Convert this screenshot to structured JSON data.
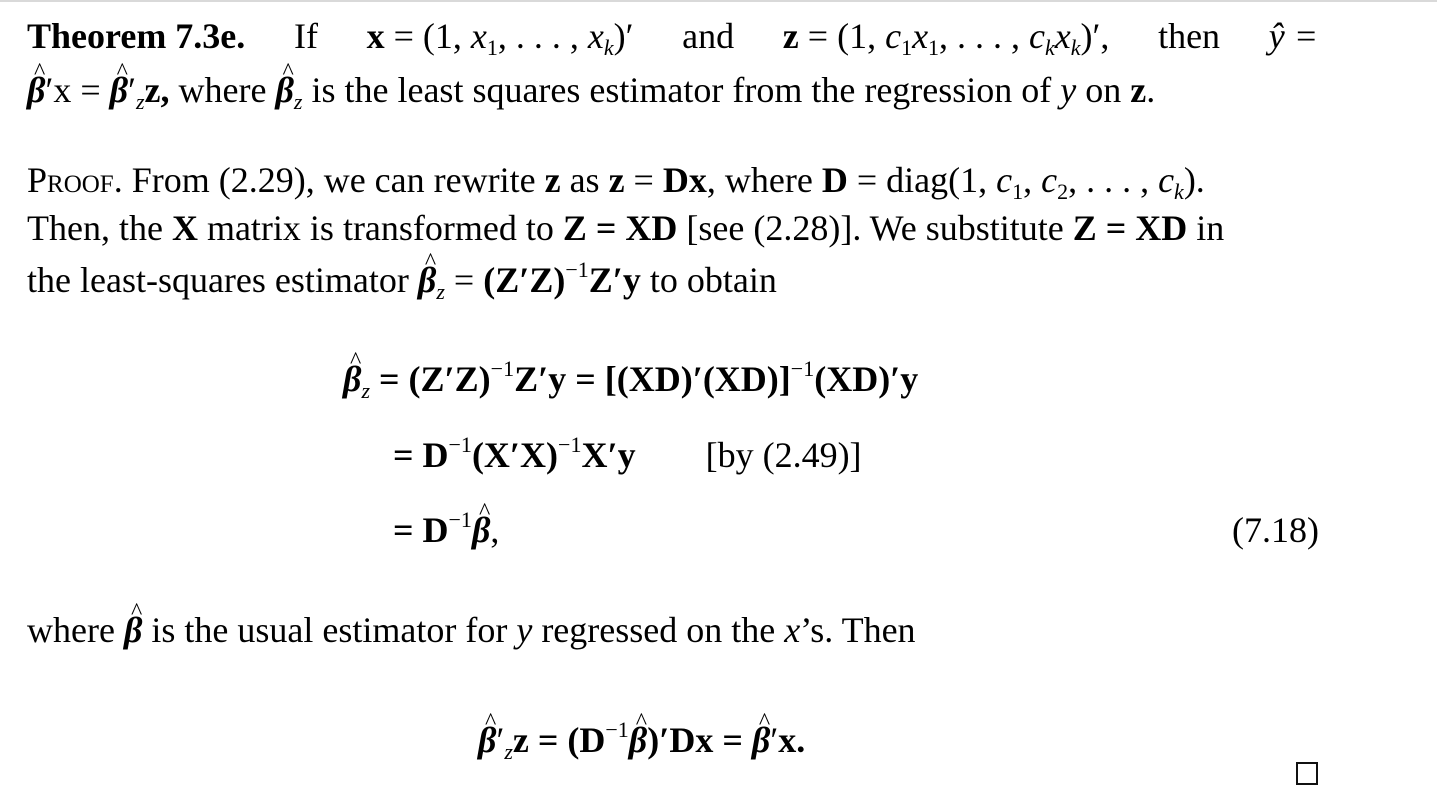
{
  "theorem": {
    "label": "Theorem 7.3e.",
    "line1": {
      "lead": "If",
      "x_def": "x = (1, x",
      "x_sub1": "1",
      "x_mid": ", . . . , x",
      "x_subk": "k",
      "x_end": ")′",
      "and": "and",
      "z_def": "z = (1, c",
      "z_sub1": "1",
      "z_x": "x",
      "z_sub1b": "1",
      "z_mid": ", . . . , c",
      "z_subk": "k",
      "z_x2": "x",
      "z_subk2": "k",
      "z_end": ")′,",
      "then": "then",
      "yhat": "ŷ =",
      "eq_tail": ""
    },
    "line2": {
      "beta1": "β",
      "p1": "′x = ",
      "beta2": "β",
      "p2": "′",
      "sub_z": "z",
      "p3": "z,",
      "where": " where ",
      "beta3": "β",
      "sub_z2": "z",
      "rest": " is the least squares estimator from the regression of ",
      "y": "y",
      "on": " on ",
      "z": "z",
      "dot": "."
    }
  },
  "proof": {
    "label": "Proof.",
    "line1": {
      "a": " From (2.29), we can rewrite ",
      "z1": "z",
      "b": " as ",
      "z2": "z",
      "c": " = ",
      "dx": "Dx",
      "d": ", where ",
      "D": "D",
      "e": " = diag(1, ",
      "c1": "c",
      "c1s": "1",
      "f": ", ",
      "c2": "c",
      "c2s": "2",
      "g": ", . . . , ",
      "ck": "c",
      "cks": "k",
      "h": ")."
    },
    "line2": {
      "a": "Then, the ",
      "X": "X",
      "b": " matrix is transformed to ",
      "zxd": "Z = XD",
      "c": " [see (2.28)]. We substitute ",
      "zxd2": "Z = XD",
      "d": " in"
    },
    "line3": {
      "a": "the least-squares estimator ",
      "beta": "β",
      "sub": "z",
      "b": " = ",
      "c": "(Z′Z)",
      "sup": "−1",
      "d": "Z′y",
      "e": " to obtain"
    }
  },
  "equation_block": {
    "row1": {
      "beta": "β",
      "sub": "z",
      "a": " = (Z′Z)",
      "sup1": "−1",
      "b": "Z′y = [(XD)′(XD)]",
      "sup2": "−1",
      "c": "(XD)′y"
    },
    "row2": {
      "a": "= D",
      "sup1": "−1",
      "b": "(X′X)",
      "sup2": "−1",
      "c": "X′y",
      "note": "[by (2.49)]"
    },
    "row3": {
      "a": "= D",
      "sup": "−1",
      "beta": "β",
      "b": ","
    },
    "number": "(7.18)"
  },
  "after": {
    "a": "where ",
    "beta": "β",
    "b": " is the usual estimator for ",
    "y": "y",
    "c": " regressed on the ",
    "x": "x",
    "d": "’s. Then"
  },
  "final_equation": {
    "beta1": "β",
    "p1": "′",
    "sub": "z",
    "a": "z = (D",
    "sup": "−1",
    "beta2": "β",
    "b": ")′Dx = ",
    "beta3": "β",
    "p3": "′",
    "c": "x."
  },
  "qed_symbol": "end-of-proof-box"
}
